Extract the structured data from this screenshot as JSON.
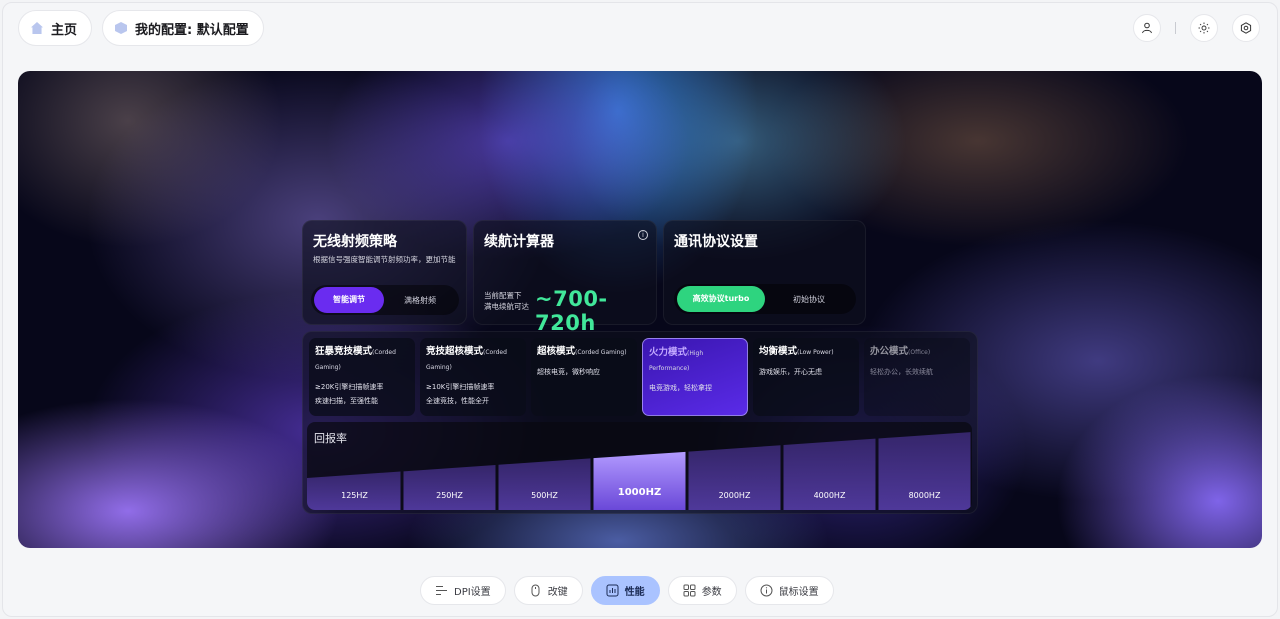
{
  "topbar": {
    "home_label": "主页",
    "config_label": "我的配置: 默认配置"
  },
  "hero": {
    "rf": {
      "title": "无线射频策略",
      "desc": "根据信号强度智能调节射频功率，更加节能",
      "options": [
        "智能调节",
        "满格射频"
      ],
      "selected": 0
    },
    "calc": {
      "title": "续航计算器",
      "info_glyph": "i",
      "sub_line1": "当前配置下",
      "sub_line2": "满电续航可达",
      "value": "~700-720h"
    },
    "protocol": {
      "title": "通讯协议设置",
      "options": [
        "高效协议turbo",
        "初始协议"
      ],
      "selected": 0
    },
    "modes": [
      {
        "name": "狂暴竞技模式",
        "sub": "(Corded Gaming)",
        "desc1": "≥20K引擎扫描帧速率",
        "desc2": "疾速扫描，至强性能"
      },
      {
        "name": "竞技超核模式",
        "sub": "(Corded Gaming)",
        "desc1": "≥10K引擎扫描帧速率",
        "desc2": "全速竞技，性能全开"
      },
      {
        "name": "超核模式",
        "sub": "(Corded Gaming)",
        "desc1": "超核电竞，微秒响应",
        "desc2": ""
      },
      {
        "name": "火力模式",
        "sub": "(High Performance)",
        "desc1": "电竞游戏，轻松拿捏",
        "desc2": ""
      },
      {
        "name": "均衡模式",
        "sub": "(Low Power)",
        "desc1": "游戏娱乐，开心无虑",
        "desc2": ""
      },
      {
        "name": "办公模式",
        "sub": "(Office)",
        "desc1": "轻松办公，长效续航",
        "desc2": ""
      }
    ],
    "active_mode": 3,
    "report_rate": {
      "title": "回报率",
      "options": [
        "125HZ",
        "250HZ",
        "500HZ",
        "1000HZ",
        "2000HZ",
        "4000HZ",
        "8000HZ"
      ],
      "selected": 3
    }
  },
  "bottomnav": [
    {
      "label": "DPI设置",
      "icon": "dpi-icon"
    },
    {
      "label": "改键",
      "icon": "mouse-icon"
    },
    {
      "label": "性能",
      "icon": "performance-icon"
    },
    {
      "label": "参数",
      "icon": "grid-icon"
    },
    {
      "label": "鼠标设置",
      "icon": "info-circle-icon"
    }
  ],
  "active_nav": 2,
  "colors": {
    "accent_purple": "#6a2cf0",
    "accent_green": "#2ed47f",
    "value_green": "#41e79a",
    "nav_active": "#aac3ff"
  }
}
